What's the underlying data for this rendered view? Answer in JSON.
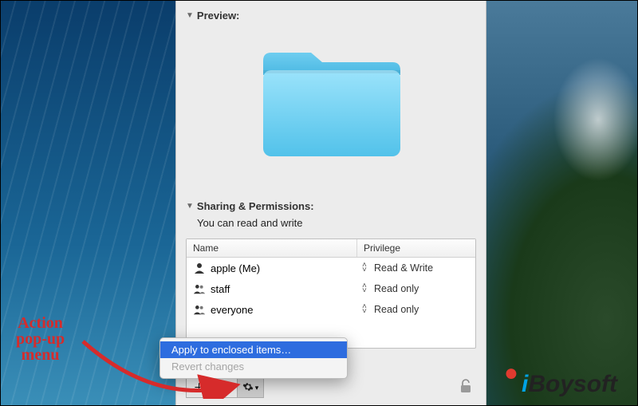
{
  "sections": {
    "preview": {
      "label": "Preview:"
    },
    "sharing": {
      "label": "Sharing & Permissions:",
      "description": "You can read and write",
      "columns": {
        "name": "Name",
        "privilege": "Privilege"
      },
      "rows": [
        {
          "name": "apple (Me)",
          "privilege": "Read & Write",
          "icon": "single"
        },
        {
          "name": "staff",
          "privilege": "Read only",
          "icon": "group"
        },
        {
          "name": "everyone",
          "privilege": "Read only",
          "icon": "group"
        }
      ]
    }
  },
  "popup": {
    "apply": "Apply to enclosed items…",
    "revert": "Revert changes"
  },
  "annotation": {
    "line1": "Action",
    "line2": "pop-up",
    "line3": "menu"
  },
  "watermark": {
    "prefix": "i",
    "rest": "Boysoft"
  },
  "colors": {
    "selection": "#2e6ddf",
    "folder": "#6ad0f3",
    "annotation": "#d62b2b"
  }
}
